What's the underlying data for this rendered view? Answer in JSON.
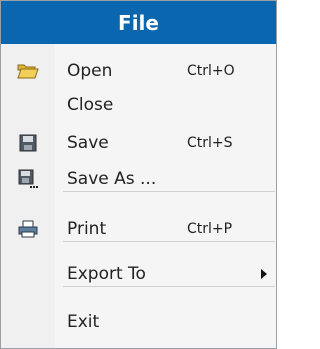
{
  "menu": {
    "title": "File",
    "items": [
      {
        "label": "Open",
        "shortcut": "Ctrl+O",
        "icon": "folder-open-icon"
      },
      {
        "label": "Close",
        "shortcut": "",
        "icon": ""
      },
      {
        "label": "Save",
        "shortcut": "Ctrl+S",
        "icon": "floppy-disk-icon"
      },
      {
        "label": "Save As ...",
        "shortcut": "",
        "icon": "floppy-disk-save-as-icon"
      },
      {
        "label": "Print",
        "shortcut": "Ctrl+P",
        "icon": "printer-icon"
      },
      {
        "label": "Export To",
        "shortcut": "",
        "icon": "",
        "has_submenu": true
      },
      {
        "label": "Exit",
        "shortcut": "",
        "icon": ""
      }
    ]
  },
  "colors": {
    "header_bg": "#0b66b0",
    "header_text": "#ffffff",
    "menu_bg": "#f5f5f5"
  }
}
